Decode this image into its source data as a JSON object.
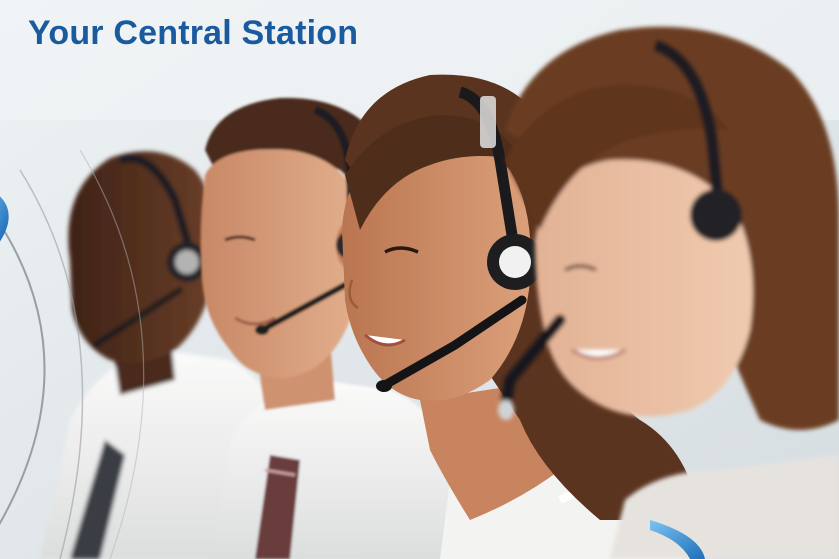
{
  "headline": {
    "text": "Your Central Station",
    "color": "#1a5a9e"
  },
  "scene": {
    "subject": "call-center-agents-with-headsets",
    "person_count": 4,
    "colors": {
      "background": "#e9eef1",
      "skin_dark": "#5a3422",
      "skin_light": "#d9a07c",
      "hair": "#5b3420",
      "shirt": "#f2f2f0",
      "headset": "#1c1c1e",
      "arc_accent": "#2f8fd6"
    }
  }
}
